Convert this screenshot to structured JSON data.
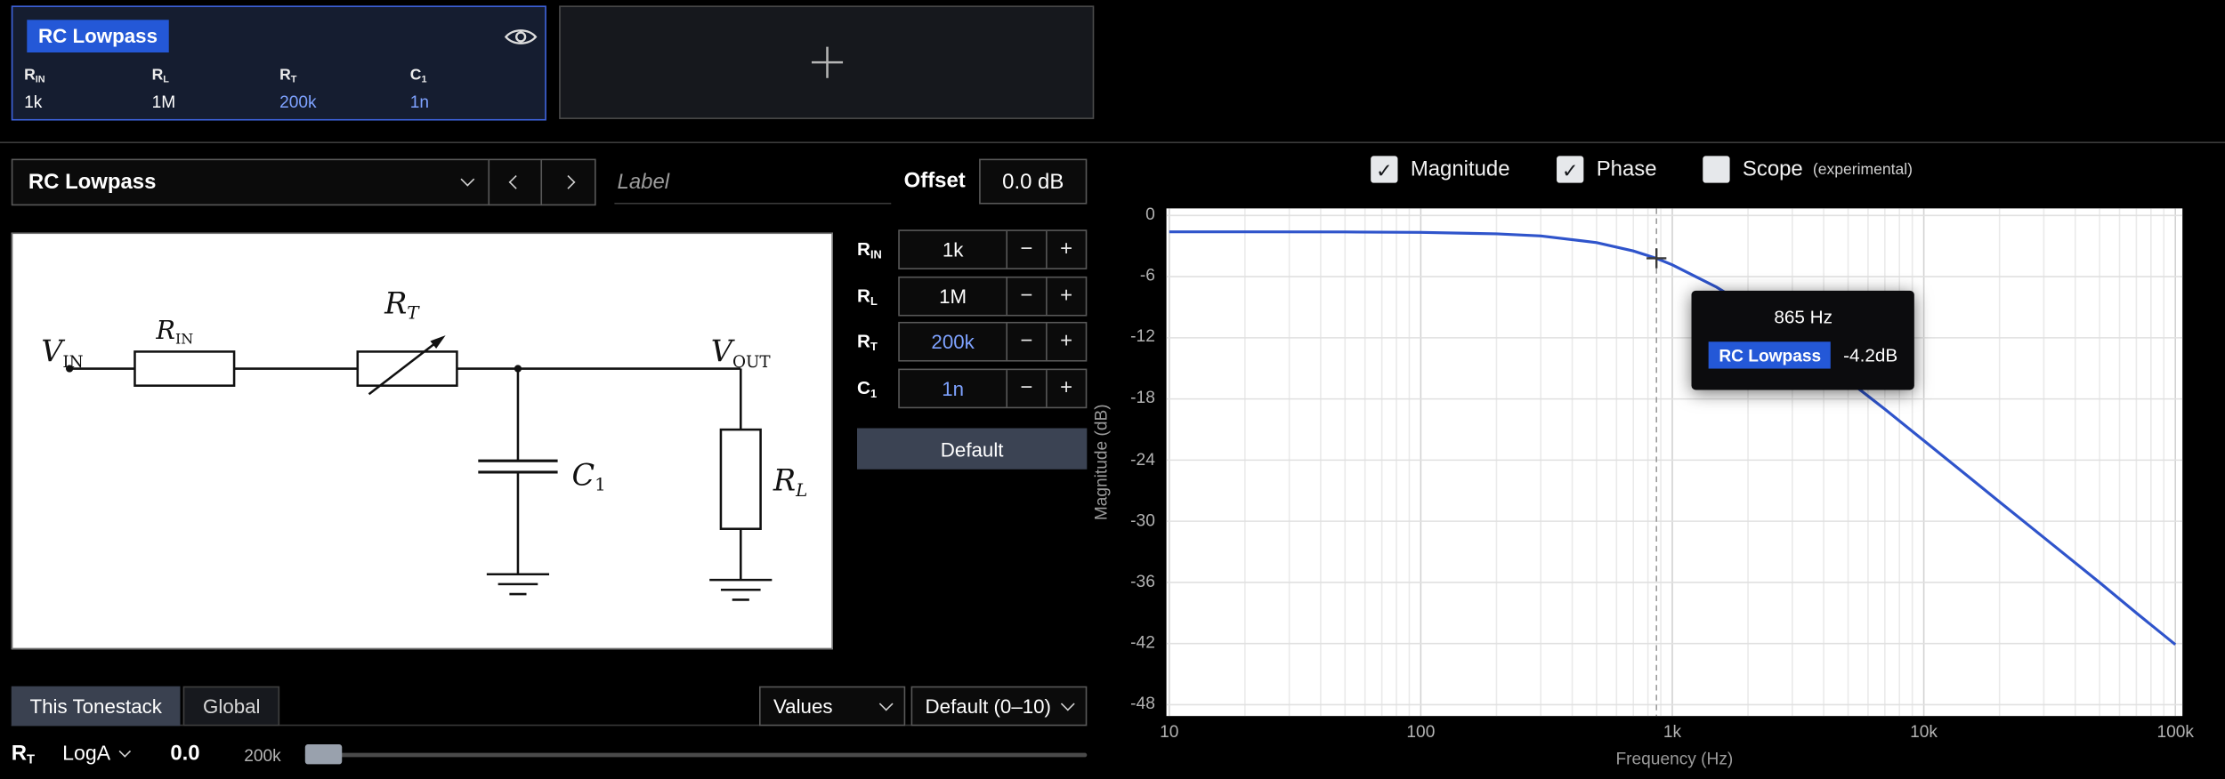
{
  "colors": {
    "accent_blue": "#2458d7",
    "modified_value_blue": "#7ea2ff",
    "curve_blue": "#2f54cb",
    "selected_card_border": "#3e63dd",
    "chart_background": "#ffffff"
  },
  "icons": {
    "check_glyph": "✓",
    "minus_glyph": "−",
    "plus_glyph": "+"
  },
  "library": {
    "selected_card": {
      "title": "RC Lowpass",
      "params": [
        {
          "label": "R",
          "sub": "IN",
          "value": "1k",
          "modified": false
        },
        {
          "label": "R",
          "sub": "L",
          "value": "1M",
          "modified": false
        },
        {
          "label": "R",
          "sub": "T",
          "value": "200k",
          "modified": true
        },
        {
          "label": "C",
          "sub": "1",
          "value": "1n",
          "modified": true
        }
      ]
    }
  },
  "selector": {
    "value": "RC Lowpass",
    "label_placeholder": "Label",
    "offset_label": "Offset",
    "offset_value": "0.0 dB"
  },
  "circuit": {
    "vin_main": "V",
    "vin_sub": "IN",
    "vout_main": "V",
    "vout_sub": "OUT",
    "rin_main": "R",
    "rin_sub": "IN",
    "rt_main": "R",
    "rt_sub": "T",
    "c1_main": "C",
    "c1_sub": "1",
    "rl_main": "R",
    "rl_sub": "L"
  },
  "param_rows": [
    {
      "label": "R",
      "sub": "IN",
      "value": "1k",
      "modified": false
    },
    {
      "label": "R",
      "sub": "L",
      "value": "1M",
      "modified": false
    },
    {
      "label": "R",
      "sub": "T",
      "value": "200k",
      "modified": true
    },
    {
      "label": "C",
      "sub": "1",
      "value": "1n",
      "modified": true
    }
  ],
  "default_button_label": "Default",
  "tabs": [
    {
      "label": "This Tonestack",
      "active": true
    },
    {
      "label": "Global",
      "active": false
    }
  ],
  "bottom_selects": [
    {
      "value": "Values"
    },
    {
      "value": "Default (0–10)"
    }
  ],
  "slider_row": {
    "param_label": "R",
    "param_sub": "T",
    "taper": "LogA",
    "value": "0.0",
    "range_label": "200k"
  },
  "chart_toggles": [
    {
      "label": "Magnitude",
      "checked": true
    },
    {
      "label": "Phase",
      "checked": true
    },
    {
      "label": "Scope",
      "suffix": "(experimental)",
      "checked": false
    }
  ],
  "chart_data": {
    "type": "line",
    "title": "",
    "xlabel": "Frequency (Hz)",
    "ylabel": "Magnitude (dB)",
    "x_scale": "log",
    "xlim": [
      10,
      100000
    ],
    "ylim": [
      -48,
      0
    ],
    "grid": true,
    "legend": "none",
    "y_ticks": [
      0,
      -6,
      -12,
      -18,
      -24,
      -30,
      -36,
      -42,
      -48
    ],
    "x_ticks": [
      {
        "f": 10,
        "label": "10"
      },
      {
        "f": 100,
        "label": "100"
      },
      {
        "f": 1000,
        "label": "1k"
      },
      {
        "f": 10000,
        "label": "10k"
      },
      {
        "f": 100000,
        "label": "100k"
      }
    ],
    "series": [
      {
        "name": "RC Lowpass",
        "color": "#2f54cb",
        "x": [
          10,
          20,
          50,
          100,
          200,
          300,
          500,
          700,
          865,
          1000,
          1500,
          2000,
          3000,
          5000,
          7000,
          10000,
          15000,
          20000,
          30000,
          50000,
          70000,
          100000
        ],
        "y": [
          -1.6,
          -1.6,
          -1.61,
          -1.65,
          -1.79,
          -2.01,
          -2.66,
          -3.48,
          -4.2,
          -4.84,
          -7.03,
          -8.95,
          -12.0,
          -16.2,
          -19.0,
          -22.1,
          -25.6,
          -28.1,
          -31.6,
          -36.0,
          -39.0,
          -42.1
        ]
      }
    ],
    "cursor": {
      "freq": 865,
      "freq_label": "865 Hz",
      "series_name": "RC Lowpass",
      "value_label": "-4.2dB",
      "db": -4.2
    }
  }
}
